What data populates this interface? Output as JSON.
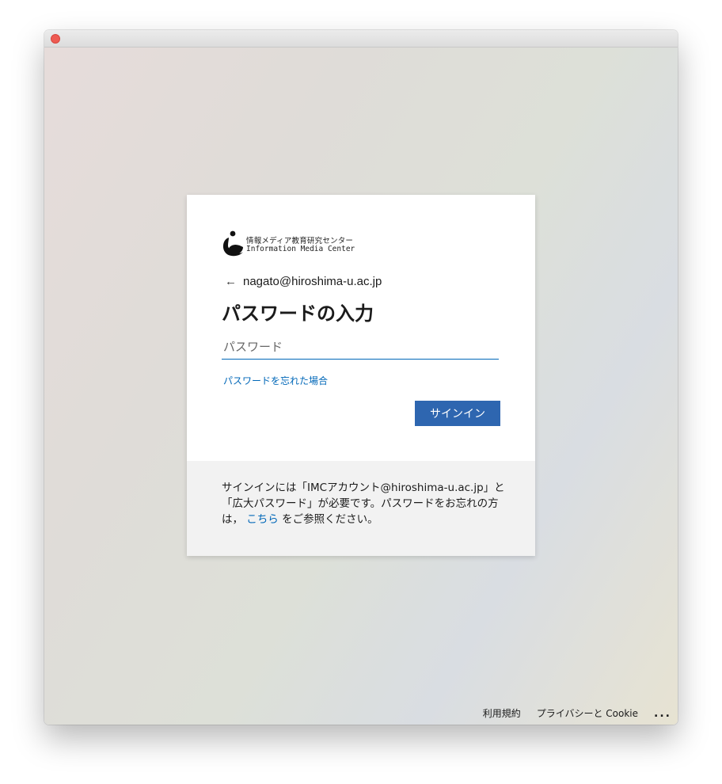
{
  "window": {
    "close_color": "#ee5b52"
  },
  "logo": {
    "name_jp": "情報メディア教育研究センター",
    "name_en": "Information Media Center"
  },
  "signin": {
    "account": "nagato@hiroshima-u.ac.jp",
    "heading": "パスワードの入力",
    "password_placeholder": "パスワード",
    "password_value": "",
    "forgot_link": "パスワードを忘れた場合",
    "signin_button": "サインイン",
    "accent_color": "#2e66b0"
  },
  "footer": {
    "text_before": "サインインには「IMCアカウント@hiroshima-u.ac.jp」と「広大パスワード」が必要です。パスワードをお忘れの方は，",
    "link_text": "こちら",
    "text_after": "をご参照ください。"
  },
  "page_links": {
    "terms": "利用規約",
    "privacy": "プライバシーと Cookie",
    "more": "..."
  }
}
